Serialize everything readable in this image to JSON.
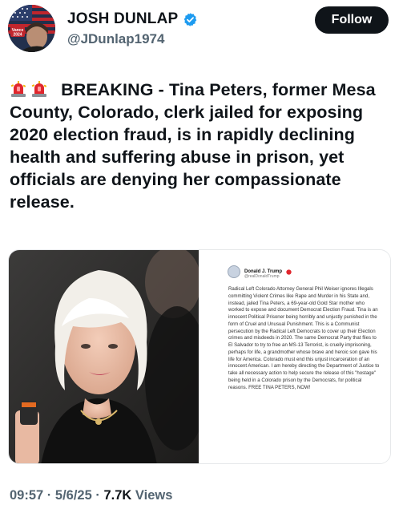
{
  "author": {
    "display_name": "JOSH DUNLAP",
    "handle": "@JDunlap1974",
    "avatar_badge": "Vance 2024",
    "verified": true
  },
  "follow_label": "Follow",
  "tweet": {
    "emoji": [
      "rotating-light",
      "rotating-light"
    ],
    "text": "BREAKING - Tina Peters, former Mesa County, Colorado, clerk jailed for exposing 2020 election fraud, is in rapidly declining health and suffering abuse in prison, yet officials are denying her compassionate release."
  },
  "embedded_post": {
    "name": "Donald J. Trump",
    "handle": "@realDonaldTrump",
    "body": "Radical Left Colorado Attorney General Phil Weiser ignores Illegals committing Violent Crimes like Rape and Murder in his State and, instead, jailed Tina Peters, a 69-year-old Gold Star mother who worked to expose and document Democrat Election Fraud. Tina is an innocent Political Prisoner being horribly and unjustly punished in the form of Cruel and Unusual Punishment. This is a Communist persecution by the Radical Left Democrats to cover up their Election crimes and misdeeds in 2020. The same Democrat Party that flies to El Salvador to try to free an MS-13 Terrorist, is cruelly imprisoning, perhaps for life, a grandmother whose brave and heroic son gave his life for America. Colorado must end this unjust incarceration of an innocent American. I am hereby directing the Department of Justice to take all necessary action to help secure the release of this \"hostage\" being held in a Colorado prison by the Democrats, for political reasons. FREE TINA PETERS, NOW!"
  },
  "meta": {
    "time": "09:57",
    "date": "5/6/25",
    "views": "7.7K",
    "views_label": "Views",
    "separator": "·"
  },
  "colors": {
    "text": "#0f1419",
    "muted": "#536471",
    "verified": "#1d9bf0",
    "follow_bg": "#0f1419"
  }
}
